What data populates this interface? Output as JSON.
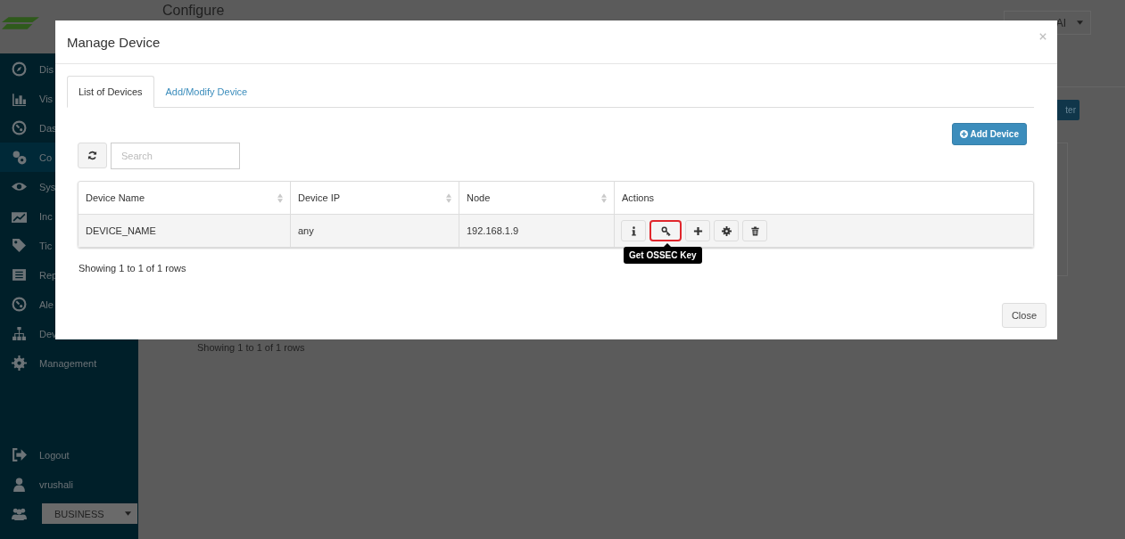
{
  "header": {
    "title": "Configure",
    "selector": "AI",
    "button": "ter"
  },
  "sidebar": {
    "items": [
      {
        "kind": "compass",
        "label": "Dis",
        "selected": false
      },
      {
        "kind": "bars",
        "label": "Vis",
        "selected": false
      },
      {
        "kind": "gauge",
        "label": "Das",
        "selected": false
      },
      {
        "kind": "gears",
        "label": "Co",
        "selected": true
      },
      {
        "kind": "eye",
        "label": "Sys",
        "selected": false
      },
      {
        "kind": "chart",
        "label": "Inc",
        "selected": false
      },
      {
        "kind": "tag",
        "label": "Tic",
        "selected": false
      },
      {
        "kind": "book",
        "label": "Rep",
        "selected": false
      },
      {
        "kind": "gauge",
        "label": "Ale",
        "selected": false
      },
      {
        "kind": "sitemap",
        "label": "Dev",
        "selected": false
      },
      {
        "kind": "gear",
        "label": "Management",
        "selected": false
      }
    ],
    "footer": [
      {
        "kind": "logout",
        "label": "Logout"
      },
      {
        "kind": "user",
        "label": "vrushali"
      }
    ],
    "group_select": "BUSINESS"
  },
  "background_status": "Showing 1 to 1 of 1 rows",
  "modal": {
    "title": "Manage Device",
    "tabs": [
      {
        "label": "List of Devices",
        "selected": true
      },
      {
        "label": "Add/Modify Device",
        "selected": false
      }
    ],
    "add_button": "Add Device",
    "search": {
      "placeholder": "Search"
    },
    "table": {
      "columns": [
        {
          "label": "Device Name",
          "sortable": true
        },
        {
          "label": "Device IP",
          "sortable": true
        },
        {
          "label": "Node",
          "sortable": true
        },
        {
          "label": "Actions",
          "sortable": false
        }
      ],
      "rows": [
        {
          "cells": [
            "DEVICE_NAME",
            "any",
            "192.168.1.9"
          ],
          "actions": [
            {
              "kind": "info",
              "highlighted": false
            },
            {
              "kind": "key",
              "highlighted": true
            },
            {
              "kind": "plus",
              "highlighted": false
            },
            {
              "kind": "gear",
              "highlighted": false
            },
            {
              "kind": "trash",
              "highlighted": false
            }
          ]
        }
      ]
    },
    "tooltip": "Get OSSEC Key",
    "status": "Showing 1 to 1 of 1 rows",
    "close_button": "Close"
  }
}
